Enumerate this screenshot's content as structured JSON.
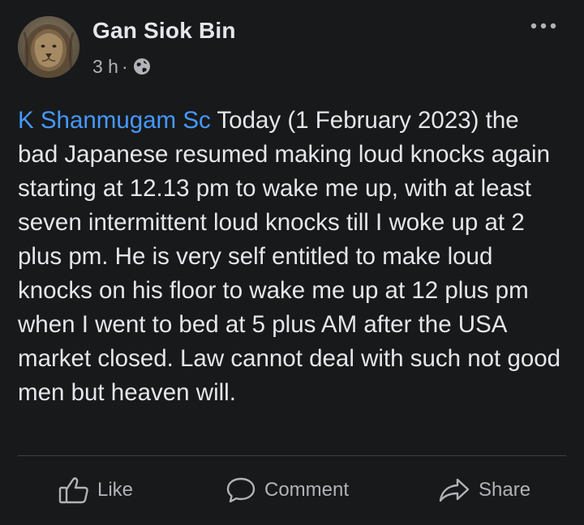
{
  "post": {
    "author": "Gan Siok Bin",
    "time": "3 h",
    "separator": "·",
    "audience_icon": "globe-icon",
    "more_icon": "more-options-icon",
    "mention": "K Shanmugam Sc",
    "body": " Today (1 February 2023) the bad Japanese resumed making loud knocks again starting at 12.13 pm to wake me up, with at least seven intermittent loud knocks till I woke up at 2 plus pm. He is very self entitled to make loud knocks on his floor to wake me up at 12 plus pm when I went to bed at 5 plus AM after the USA market closed. Law cannot deal with such not good men but heaven will."
  },
  "actions": {
    "like": {
      "label": "Like",
      "icon": "thumbs-up-icon"
    },
    "comment": {
      "label": "Comment",
      "icon": "comment-bubble-icon"
    },
    "share": {
      "label": "Share",
      "icon": "share-arrow-icon"
    }
  },
  "colors": {
    "background": "#18191a",
    "text_primary": "#e4e6eb",
    "text_secondary": "#b0b3b8",
    "mention": "#4599ff",
    "divider": "#3e4042"
  }
}
